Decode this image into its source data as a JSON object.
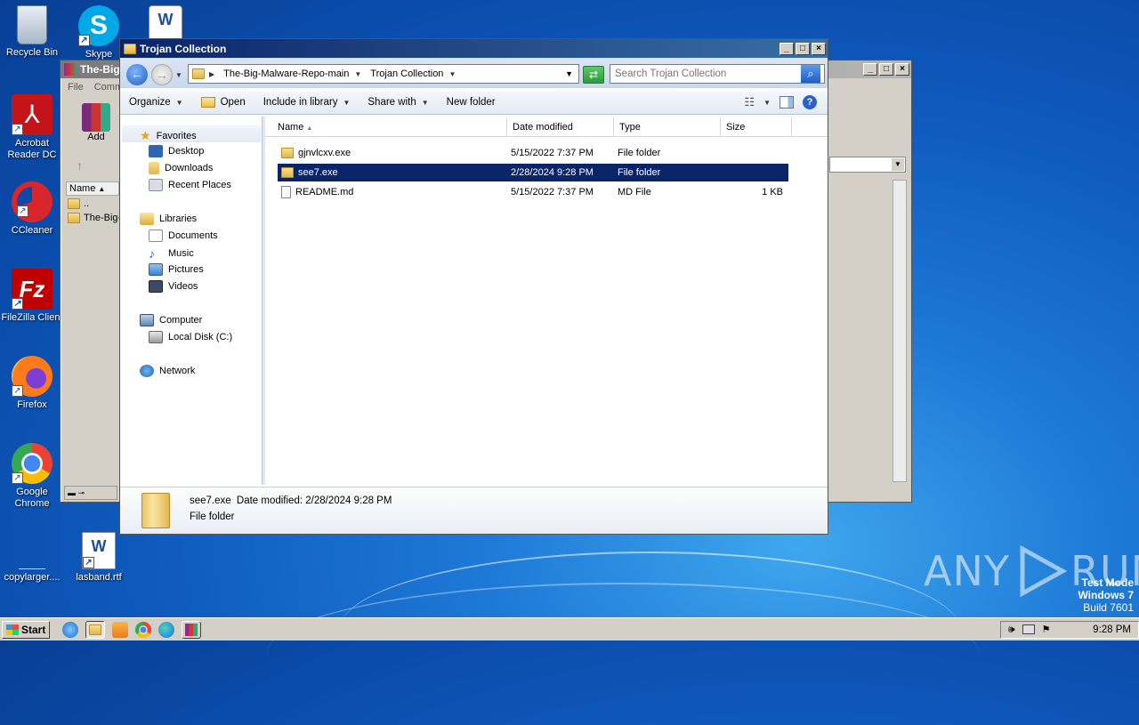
{
  "desktop": {
    "icons": [
      {
        "label": "Recycle Bin"
      },
      {
        "label": "Skype"
      },
      {
        "label": "Acrobat Reader DC"
      },
      {
        "label": "CCleaner"
      },
      {
        "label": "FileZilla Client"
      },
      {
        "label": "Firefox"
      },
      {
        "label": "Google Chrome"
      },
      {
        "label": "copylarger...."
      },
      {
        "label": "lasband.rtf"
      }
    ],
    "watermark": {
      "brand": "ANY",
      "brand2": "RUN",
      "line1": "Test Mode",
      "line2": "Windows 7",
      "line3": "Build 7601"
    }
  },
  "bg_window": {
    "title": "The-Big",
    "menu": [
      "File",
      "Comm"
    ],
    "add_label": "Add",
    "col_name": "Name",
    "rows": [
      "..",
      "The-Big-"
    ]
  },
  "explorer": {
    "title": "Trojan Collection",
    "breadcrumb": [
      "The-Big-Malware-Repo-main",
      "Trojan Collection"
    ],
    "search_placeholder": "Search Trojan Collection",
    "toolbar": {
      "organize": "Organize",
      "open": "Open",
      "include": "Include in library",
      "share": "Share with",
      "new_folder": "New folder"
    },
    "nav": {
      "favorites": "Favorites",
      "desktop": "Desktop",
      "downloads": "Downloads",
      "recent": "Recent Places",
      "libraries": "Libraries",
      "documents": "Documents",
      "music": "Music",
      "pictures": "Pictures",
      "videos": "Videos",
      "computer": "Computer",
      "local_disk": "Local Disk (C:)",
      "network": "Network"
    },
    "columns": {
      "name": "Name",
      "date": "Date modified",
      "type": "Type",
      "size": "Size"
    },
    "files": [
      {
        "name": "gjnvlcxv.exe",
        "date": "5/15/2022 7:37 PM",
        "type": "File folder",
        "size": "",
        "kind": "folder",
        "selected": false
      },
      {
        "name": "see7.exe",
        "date": "2/28/2024 9:28 PM",
        "type": "File folder",
        "size": "",
        "kind": "folder",
        "selected": true
      },
      {
        "name": "README.md",
        "date": "5/15/2022 7:37 PM",
        "type": "MD File",
        "size": "1 KB",
        "kind": "file",
        "selected": false
      }
    ],
    "details": {
      "name": "see7.exe",
      "date_label": "Date modified:",
      "date": "2/28/2024 9:28 PM",
      "type": "File folder"
    }
  },
  "taskbar": {
    "start": "Start",
    "time": "9:28 PM"
  }
}
